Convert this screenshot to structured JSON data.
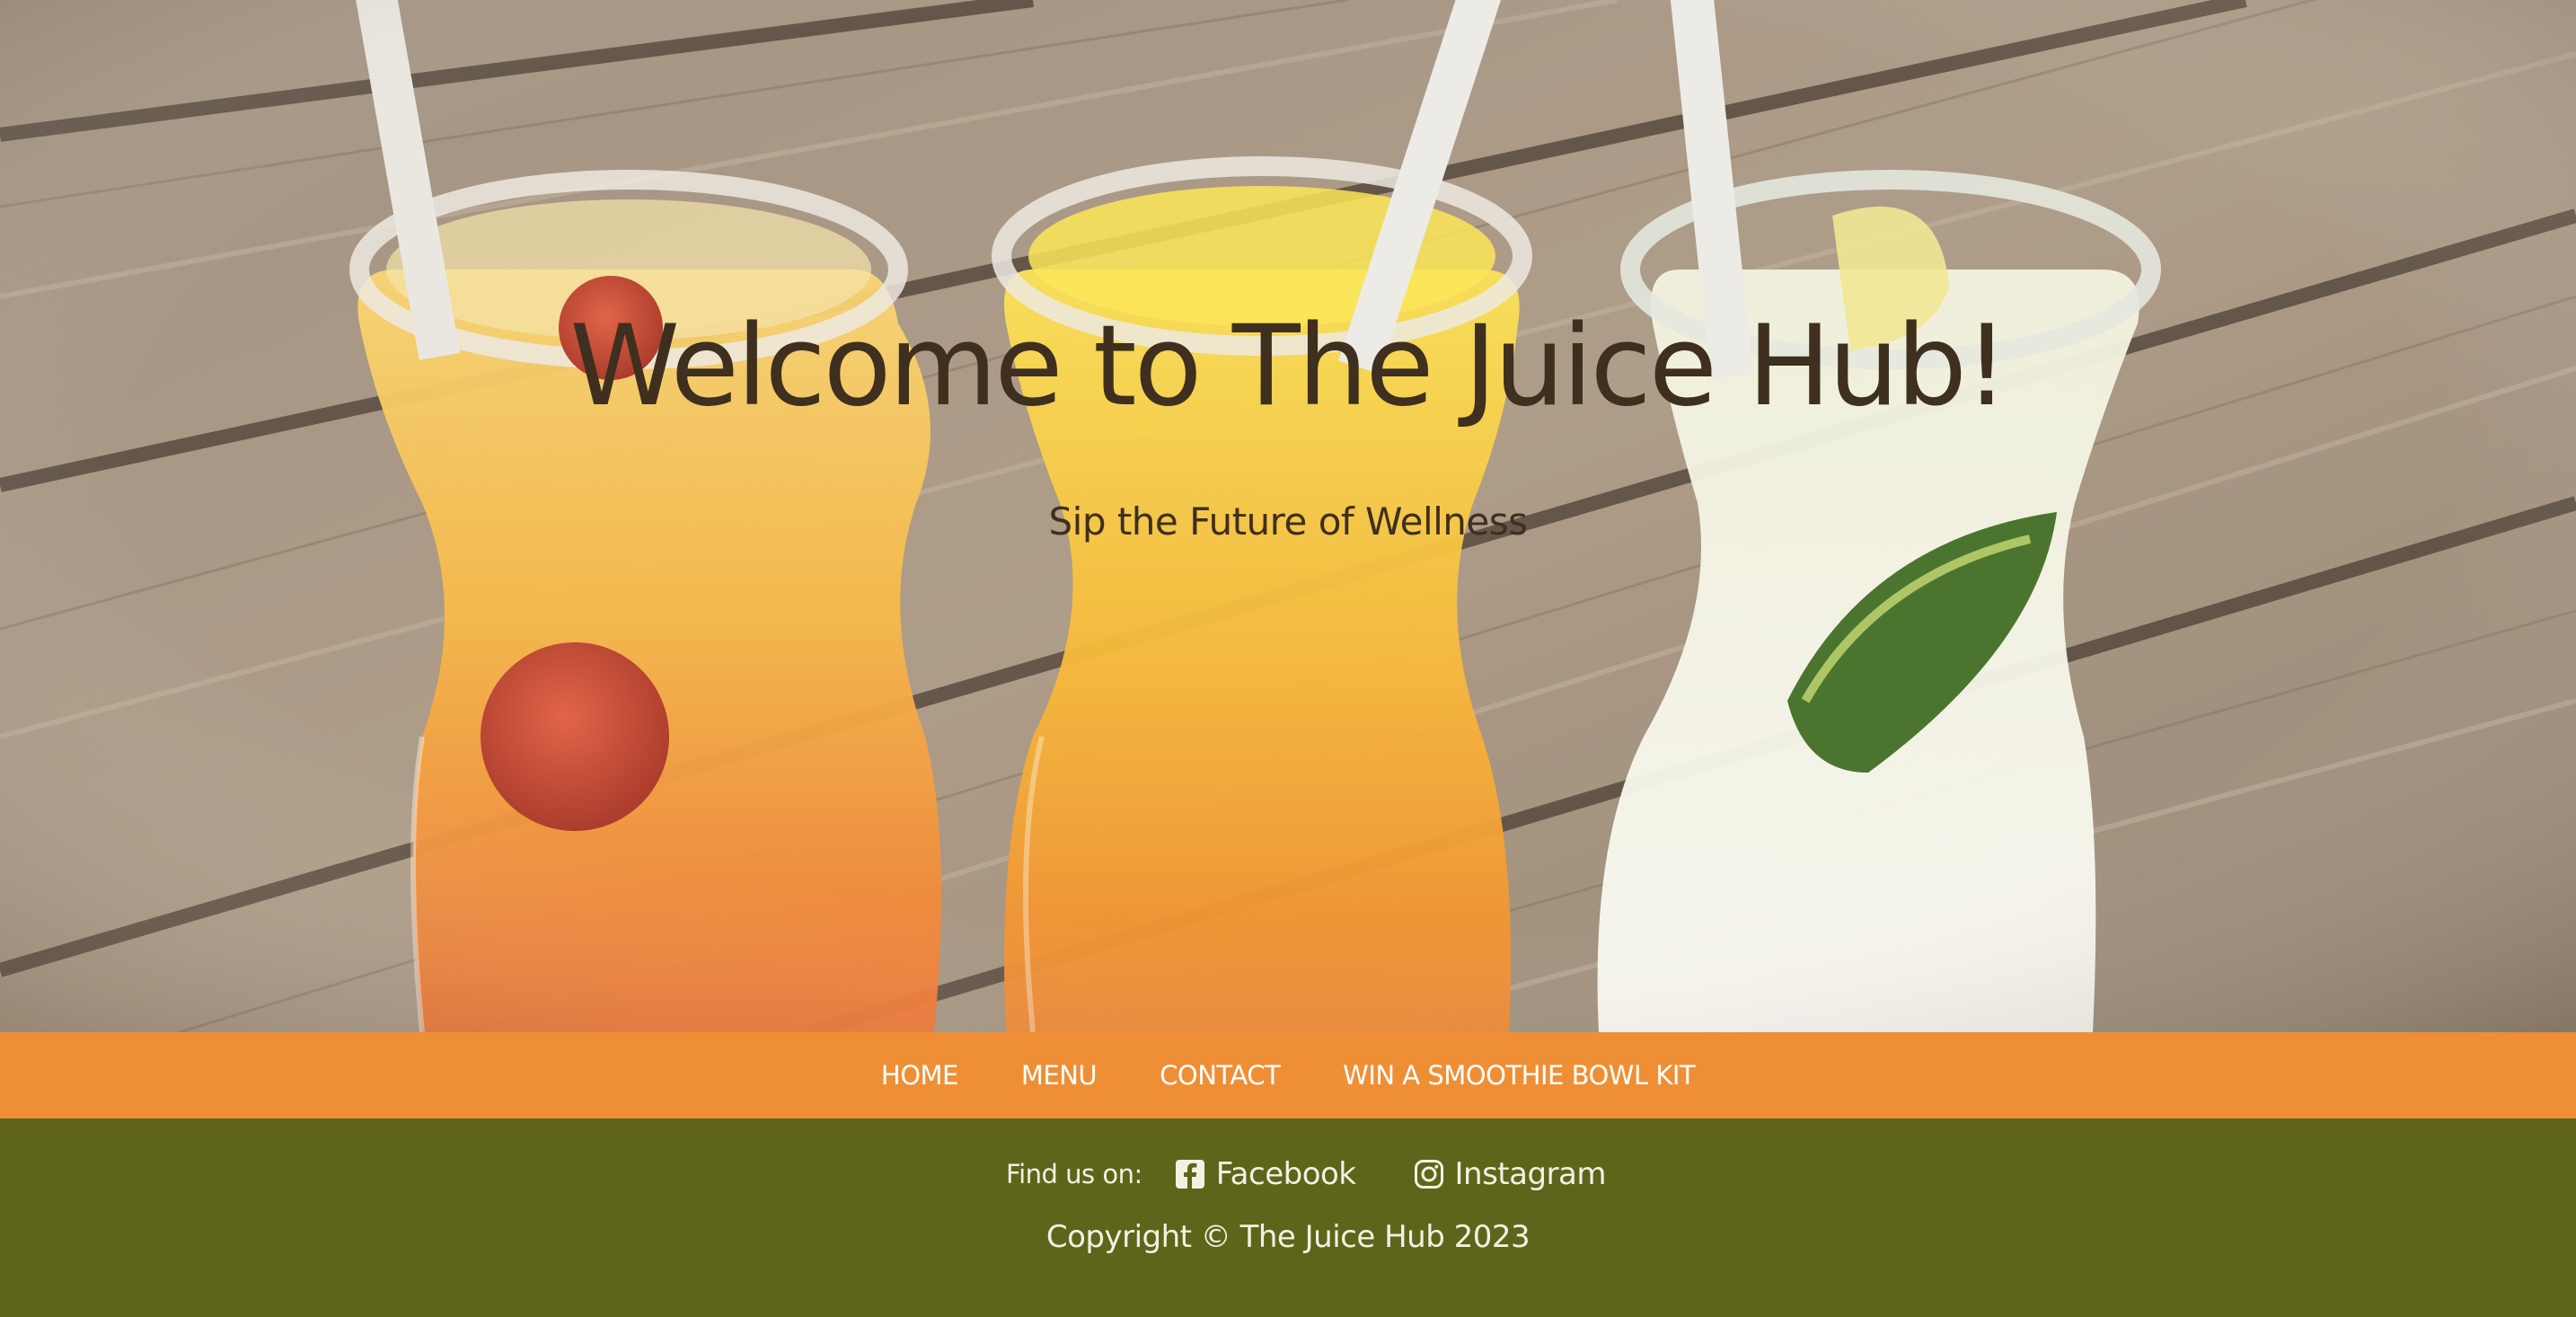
{
  "hero": {
    "title": "Welcome to The Juice Hub!",
    "subtitle": "Sip the Future of Wellness",
    "image": "three juice carafes with straws on a wooden table"
  },
  "nav": {
    "items": [
      {
        "label": "HOME"
      },
      {
        "label": "MENU"
      },
      {
        "label": "CONTACT"
      },
      {
        "label": "WIN A SMOOTHIE BOWL KIT"
      }
    ]
  },
  "footer": {
    "find_us_label": "Find us on:",
    "social": [
      {
        "label": "Facebook",
        "icon": "facebook-icon"
      },
      {
        "label": "Instagram",
        "icon": "instagram-icon"
      }
    ],
    "copyright": "Copyright © The Juice Hub 2023"
  },
  "colors": {
    "nav_background": "#ef8f35",
    "footer_background": "#5e651a",
    "hero_text": "#3e2f1f",
    "footer_text": "#f3f0e4"
  }
}
